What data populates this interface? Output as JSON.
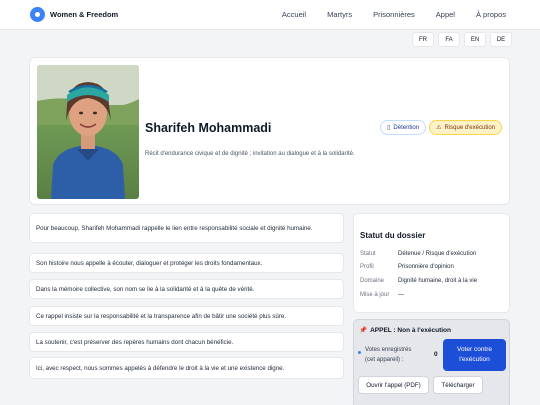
{
  "brand": {
    "name": "Women & Freedom",
    "accent": "#3b82f6"
  },
  "nav": {
    "items": [
      "Accueil",
      "Martyrs",
      "Prisonnières",
      "Appel",
      "À propos"
    ]
  },
  "languages": [
    "FR",
    "FA",
    "EN",
    "DE"
  ],
  "profile": {
    "name": "Sharifeh Mohammadi",
    "tagline": "Récit d'endurance civique et de dignité ; invitation au dialogue et à la solidarité.",
    "badges": [
      {
        "label": "Détention",
        "icon": "document-icon"
      },
      {
        "label": "Risque d'exécution",
        "icon": "warning-icon",
        "color": "#fef3c7"
      }
    ]
  },
  "story": {
    "paragraphs": [
      "Pour beaucoup, Sharifeh Mohammadi rappelle le lien entre responsabilité sociale et dignité humaine.",
      "Son histoire nous appelle à écouter, dialoguer et protéger les droits fondamentaux.",
      "Dans la mémoire collective, son nom se lie à la solidarité et à la quête de vérité.",
      "Ce rappel insiste sur la responsabilité et la transparence afin de bâtir une société plus sûre.",
      "La soutenir, c'est préserver des repères humains dont chacun bénéficie.",
      "Ici, avec respect, nous sommes appelés à défendre le droit à la vie et une existence digne."
    ]
  },
  "status": {
    "title": "Statut du dossier",
    "rows": [
      {
        "key": "Statut",
        "value": "Détenue / Risque d'exécution"
      },
      {
        "key": "Profil",
        "value": "Prisonnière d'opinion"
      },
      {
        "key": "Domaine",
        "value": "Dignité humaine, droit à la vie"
      },
      {
        "key": "Mise à jour",
        "value": "—"
      }
    ]
  },
  "appeal": {
    "title": "APPEL : Non à l'exécution",
    "icon": "pin-icon",
    "votes_label_1": "Votes enregistrés",
    "votes_label_2": "(cet appareil) :",
    "votes_count": "0",
    "vote_button": "Voter contre l'exécution",
    "open_pdf": "Ouvrir l'appel (PDF)",
    "download": "Télécharger",
    "button_color": "#1d4ed8"
  }
}
